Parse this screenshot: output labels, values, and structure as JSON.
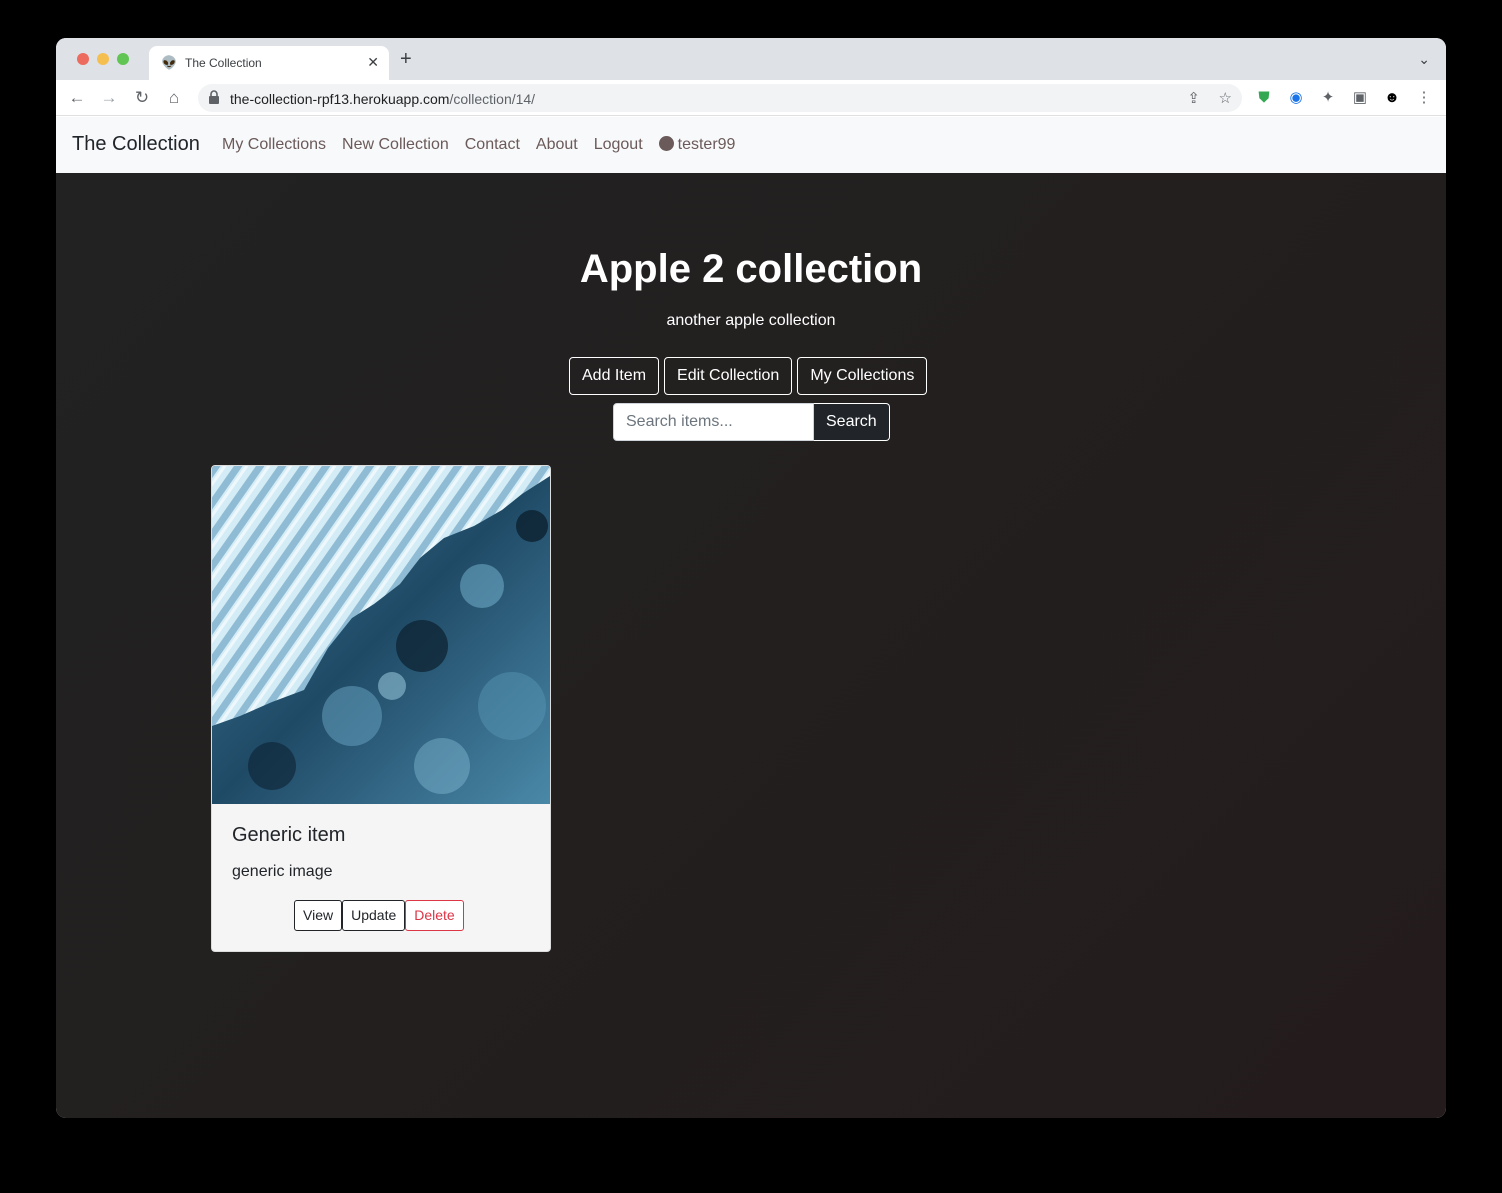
{
  "browser": {
    "tab_title": "The Collection",
    "tab_icon": "alien-icon",
    "url_host": "the-collection-rpf13.herokuapp.com",
    "url_path": "/collection/14/"
  },
  "navbar": {
    "brand": "The Collection",
    "links": [
      "My Collections",
      "New Collection",
      "Contact",
      "About",
      "Logout"
    ],
    "username": "tester99"
  },
  "page": {
    "title": "Apple 2 collection",
    "description": "another apple collection",
    "buttons": {
      "add_item": "Add Item",
      "edit_collection": "Edit Collection",
      "my_collections": "My Collections"
    },
    "search": {
      "placeholder": "Search items...",
      "button": "Search"
    }
  },
  "items": [
    {
      "title": "Generic item",
      "description": "generic image",
      "image": "satellite-ice-image",
      "actions": {
        "view": "View",
        "update": "Update",
        "delete": "Delete"
      }
    }
  ],
  "colors": {
    "delete": "#dc3545",
    "nav_link": "#6b5a5a",
    "background": "#241c1c"
  }
}
